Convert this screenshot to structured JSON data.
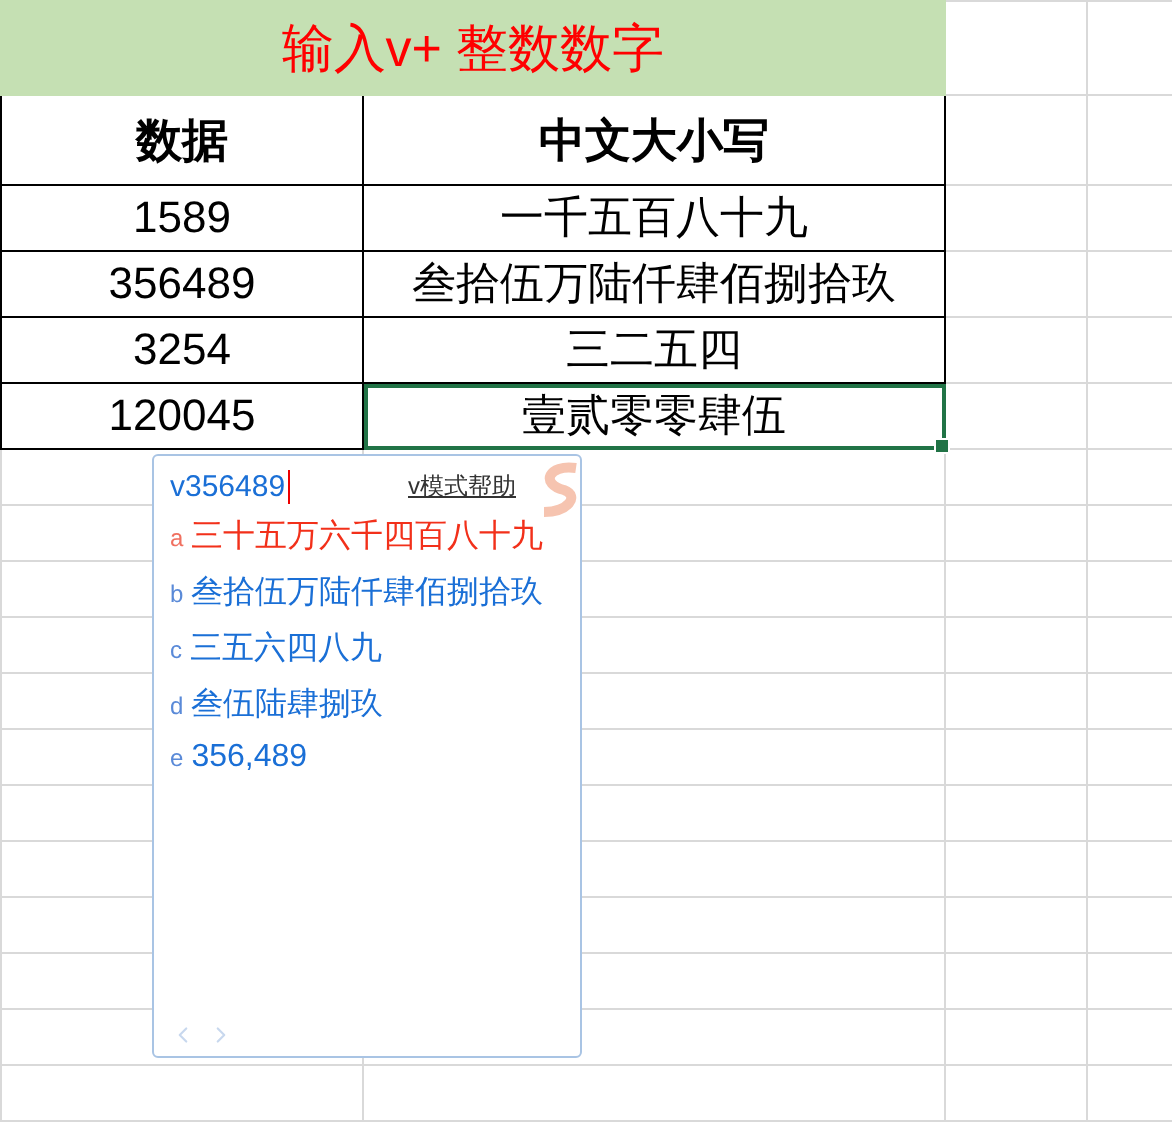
{
  "title": "输入v+ 整数数字",
  "headers": [
    "数据",
    "中文大小写"
  ],
  "rows": [
    {
      "number": "1589",
      "chinese": "一千五百八十九",
      "selected": false
    },
    {
      "number": "356489",
      "chinese": "叁拾伍万陆仟肆佰捌拾玖",
      "selected": false
    },
    {
      "number": "3254",
      "chinese": "三二五四",
      "selected": false
    },
    {
      "number": "120045",
      "chinese": "壹贰零零肆伍",
      "selected": true
    }
  ],
  "ime": {
    "input": "v356489",
    "help_link": "v模式帮助",
    "candidates": [
      {
        "key": "a",
        "text": "三十五万六千四百八十九",
        "selected": true
      },
      {
        "key": "b",
        "text": "叁拾伍万陆仟肆佰捌拾玖",
        "selected": false
      },
      {
        "key": "c",
        "text": "三五六四八九",
        "selected": false
      },
      {
        "key": "d",
        "text": "叁伍陆肆捌玖",
        "selected": false
      },
      {
        "key": "e",
        "text": "356,489",
        "selected": false
      }
    ]
  }
}
